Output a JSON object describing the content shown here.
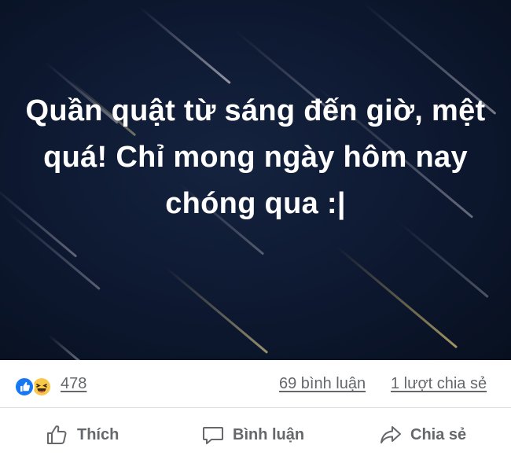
{
  "post": {
    "text": "Quần quật từ sáng đến giờ, mệt quá! Chỉ mong ngày hôm nay chóng qua :|",
    "background": "#0d1830"
  },
  "reactions": {
    "icons": [
      "like-icon",
      "haha-icon"
    ],
    "count": "478",
    "comments": "69 bình luận",
    "shares": "1 lượt chia sẻ"
  },
  "actions": {
    "like": "Thích",
    "comment": "Bình luận",
    "share": "Chia sẻ"
  },
  "colors": {
    "like_blue": "#1877f2",
    "haha_yellow": "#f7c84a",
    "secondary_text": "#65676b"
  }
}
